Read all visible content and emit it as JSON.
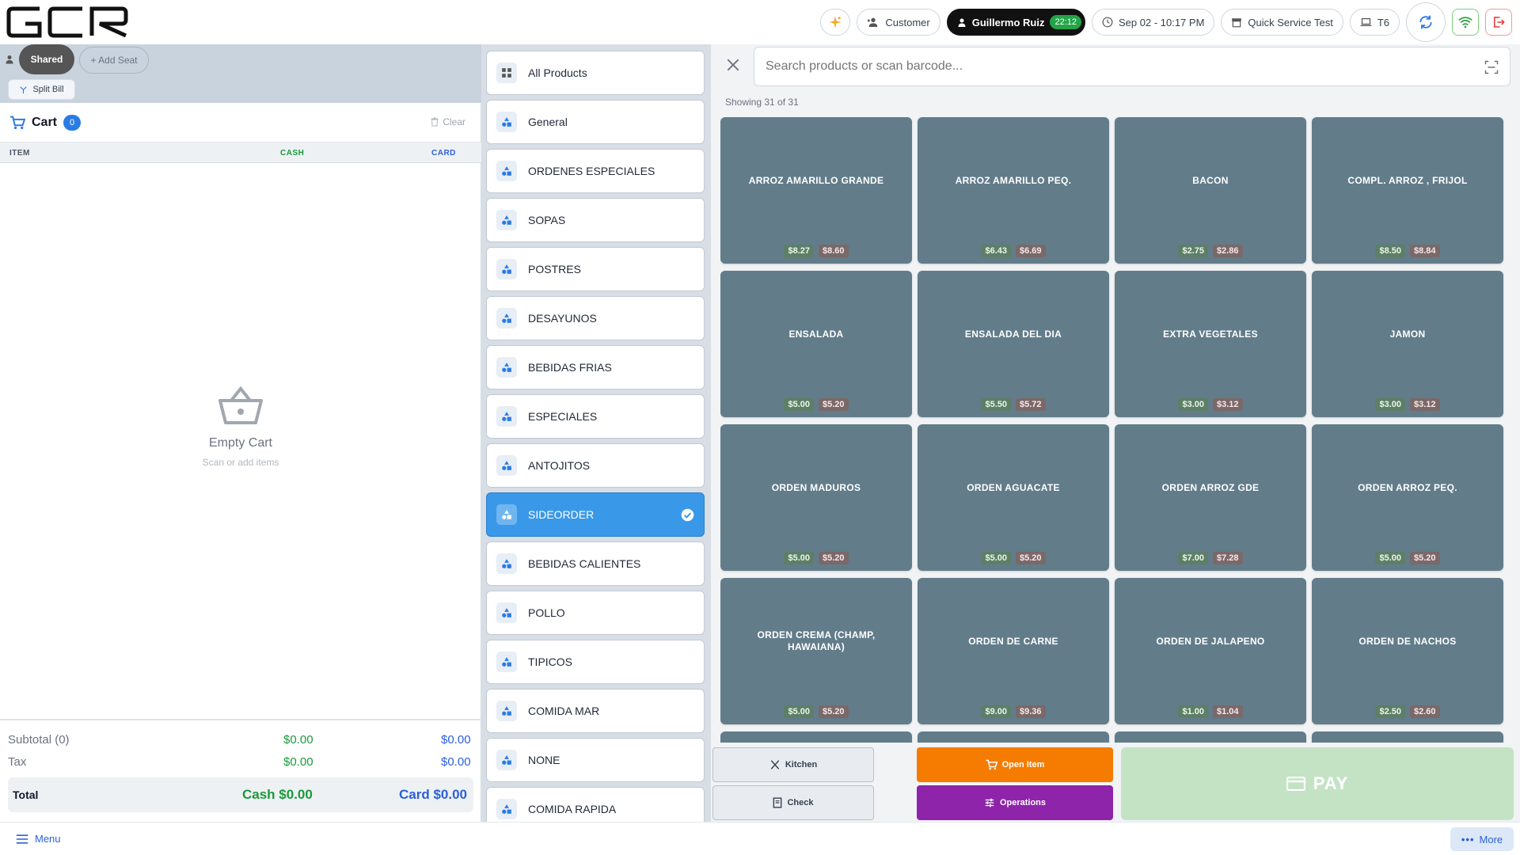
{
  "header": {
    "logo_text": "GCR",
    "customer_label": "Customer",
    "user_name": "Guillermo Ruiz",
    "user_timer": "22:12",
    "datetime": "Sep 02 - 10:17 PM",
    "service_mode": "Quick Service Test",
    "terminal": "T6"
  },
  "seats": {
    "shared_label": "Shared",
    "add_seat_label": "+ Add Seat",
    "split_bill_label": "Split Bill"
  },
  "cart": {
    "title": "Cart",
    "count": "0",
    "clear_label": "Clear",
    "col_item": "ITEM",
    "col_cash": "CASH",
    "col_card": "CARD",
    "empty_title": "Empty Cart",
    "empty_sub": "Scan or add items",
    "subtotal_label": "Subtotal (0)",
    "subtotal_cash": "$0.00",
    "subtotal_card": "$0.00",
    "tax_label": "Tax",
    "tax_cash": "$0.00",
    "tax_card": "$0.00",
    "total_label": "Total",
    "total_cash": "Cash $0.00",
    "total_card": "Card $0.00"
  },
  "categories": [
    {
      "label": "All Products",
      "icon": "grid-icon",
      "active": false
    },
    {
      "label": "General",
      "icon": "shapes-icon",
      "active": false
    },
    {
      "label": "ORDENES ESPECIALES",
      "icon": "shapes-icon",
      "active": false
    },
    {
      "label": "SOPAS",
      "icon": "shapes-icon",
      "active": false
    },
    {
      "label": "POSTRES",
      "icon": "shapes-icon",
      "active": false
    },
    {
      "label": "DESAYUNOS",
      "icon": "shapes-icon",
      "active": false
    },
    {
      "label": "BEBIDAS FRIAS",
      "icon": "shapes-icon",
      "active": false
    },
    {
      "label": "ESPECIALES",
      "icon": "shapes-icon",
      "active": false
    },
    {
      "label": "ANTOJITOS",
      "icon": "shapes-icon",
      "active": false
    },
    {
      "label": "SIDEORDER",
      "icon": "shapes-icon",
      "active": true
    },
    {
      "label": "BEBIDAS CALIENTES",
      "icon": "shapes-icon",
      "active": false
    },
    {
      "label": "POLLO",
      "icon": "shapes-icon",
      "active": false
    },
    {
      "label": "TIPICOS",
      "icon": "shapes-icon",
      "active": false
    },
    {
      "label": "COMIDA MAR",
      "icon": "shapes-icon",
      "active": false
    },
    {
      "label": "NONE",
      "icon": "shapes-icon",
      "active": false
    },
    {
      "label": "COMIDA RAPIDA",
      "icon": "shapes-icon",
      "active": false
    }
  ],
  "search": {
    "placeholder": "Search products or scan barcode..."
  },
  "showing": "Showing 31 of 31",
  "products": [
    {
      "name": "ARROZ AMARILLO GRANDE",
      "cash": "$8.27",
      "card": "$8.60"
    },
    {
      "name": "ARROZ AMARILLO PEQ.",
      "cash": "$6.43",
      "card": "$6.69"
    },
    {
      "name": "BACON",
      "cash": "$2.75",
      "card": "$2.86"
    },
    {
      "name": "COMPL. ARROZ , FRIJOL",
      "cash": "$8.50",
      "card": "$8.84"
    },
    {
      "name": "ENSALADA",
      "cash": "$5.00",
      "card": "$5.20"
    },
    {
      "name": "ENSALADA DEL DIA",
      "cash": "$5.50",
      "card": "$5.72"
    },
    {
      "name": "EXTRA  VEGETALES",
      "cash": "$3.00",
      "card": "$3.12"
    },
    {
      "name": "JAMON",
      "cash": "$3.00",
      "card": "$3.12"
    },
    {
      "name": "ORDEN  MADUROS",
      "cash": "$5.00",
      "card": "$5.20"
    },
    {
      "name": "ORDEN AGUACATE",
      "cash": "$5.00",
      "card": "$5.20"
    },
    {
      "name": "ORDEN ARROZ GDE",
      "cash": "$7.00",
      "card": "$7.28"
    },
    {
      "name": "ORDEN ARROZ PEQ.",
      "cash": "$5.00",
      "card": "$5.20"
    },
    {
      "name": "ORDEN CREMA (CHAMP, HAWAIANA)",
      "cash": "$5.00",
      "card": "$5.20"
    },
    {
      "name": "ORDEN DE CARNE",
      "cash": "$9.00",
      "card": "$9.36"
    },
    {
      "name": "ORDEN DE JALAPENO",
      "cash": "$1.00",
      "card": "$1.04"
    },
    {
      "name": "ORDEN DE NACHOS",
      "cash": "$2.50",
      "card": "$2.60"
    }
  ],
  "actions": {
    "kitchen": "Kitchen",
    "open_item": "Open Item",
    "check": "Check",
    "operations": "Operations",
    "pay": "PAY"
  },
  "bottom": {
    "menu": "Menu",
    "more": "More"
  },
  "colors": {
    "accent_blue": "#2b7be4",
    "active_category": "#3a98e8",
    "tile": "#627c8a",
    "cash_green": "#1a9a3a",
    "card_blue": "#2b5fd9",
    "orange": "#f57c00",
    "purple": "#8e24aa",
    "pay_disabled": "#c4e3c5"
  }
}
